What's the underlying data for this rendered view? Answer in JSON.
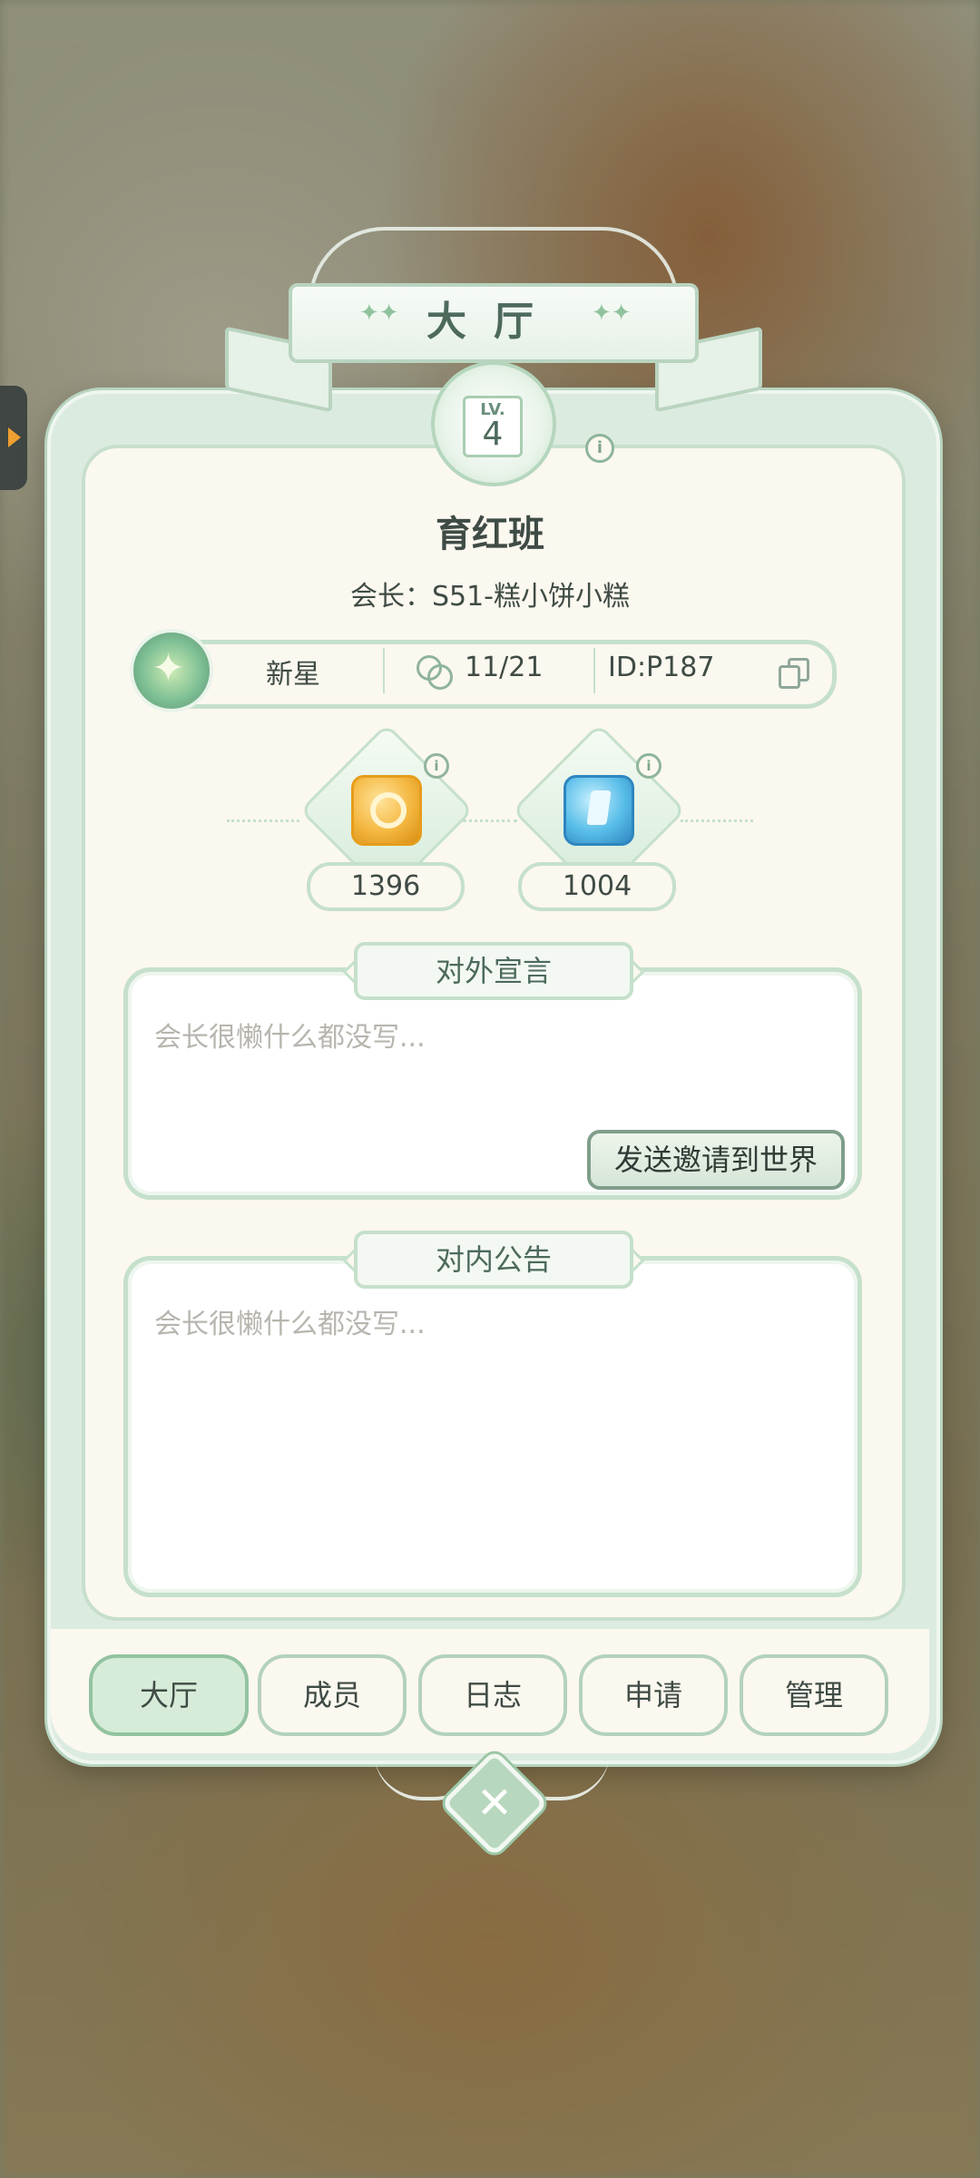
{
  "header": {
    "title": "大厅"
  },
  "guild": {
    "level_prefix": "LV.",
    "level": "4",
    "name": "育红班",
    "leader": "会长：S51-糕小饼小糕",
    "rank": "新星",
    "members": "11/21",
    "id": "ID:P187"
  },
  "resources": [
    {
      "icon": "gold-coin-icon",
      "value": "1396"
    },
    {
      "icon": "blue-gem-icon",
      "value": "1004"
    }
  ],
  "external_declaration": {
    "title": "对外宣言",
    "text": "会长很懒什么都没写...",
    "send_button": "发送邀请到世界"
  },
  "internal_notice": {
    "title": "对内公告",
    "text": "会长很懒什么都没写..."
  },
  "tabs": [
    {
      "label": "大厅",
      "active": true
    },
    {
      "label": "成员",
      "active": false
    },
    {
      "label": "日志",
      "active": false
    },
    {
      "label": "申请",
      "active": false
    },
    {
      "label": "管理",
      "active": false
    }
  ],
  "colors": {
    "accent": "#c5e0cb",
    "panel": "#fbf8ef",
    "text": "#3f4b45"
  }
}
